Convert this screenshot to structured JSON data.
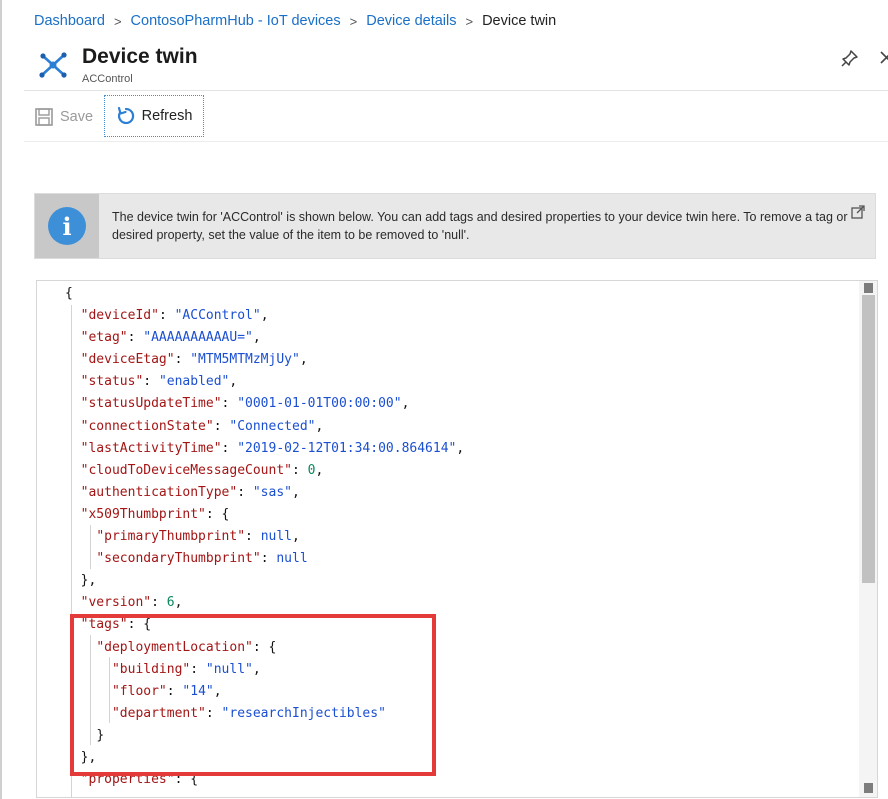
{
  "breadcrumb": {
    "items": [
      "Dashboard",
      "ContosoPharmHub - IoT devices",
      "Device details"
    ],
    "current": "Device twin",
    "separator": ">"
  },
  "header": {
    "title": "Device twin",
    "subtitle": "ACControl",
    "icon": "device-twin-icon"
  },
  "toolbar": {
    "save_label": "Save",
    "refresh_label": "Refresh"
  },
  "info_banner": {
    "text": "The device twin for 'ACControl' is shown below. You can add tags and desired properties to your device twin here. To remove a tag or desired property, set the value of the item to be removed to 'null'."
  },
  "colors": {
    "link": "#1a6fc7",
    "json_key": "#a31515",
    "json_string": "#1b4fd1",
    "json_number": "#09885a",
    "highlight": "#e43a3a",
    "info_icon": "#3d8fd8"
  },
  "editor": {
    "lines": [
      {
        "indent": 0,
        "parts": [
          [
            "p",
            "{"
          ]
        ]
      },
      {
        "indent": 1,
        "parts": [
          [
            "k",
            "\"deviceId\""
          ],
          [
            "p",
            ": "
          ],
          [
            "s",
            "\"ACControl\""
          ],
          [
            "p",
            ","
          ]
        ]
      },
      {
        "indent": 1,
        "parts": [
          [
            "k",
            "\"etag\""
          ],
          [
            "p",
            ": "
          ],
          [
            "s",
            "\"AAAAAAAAAAU=\""
          ],
          [
            "p",
            ","
          ]
        ]
      },
      {
        "indent": 1,
        "parts": [
          [
            "k",
            "\"deviceEtag\""
          ],
          [
            "p",
            ": "
          ],
          [
            "s",
            "\"MTM5MTMzMjUy\""
          ],
          [
            "p",
            ","
          ]
        ]
      },
      {
        "indent": 1,
        "parts": [
          [
            "k",
            "\"status\""
          ],
          [
            "p",
            ": "
          ],
          [
            "s",
            "\"enabled\""
          ],
          [
            "p",
            ","
          ]
        ]
      },
      {
        "indent": 1,
        "parts": [
          [
            "k",
            "\"statusUpdateTime\""
          ],
          [
            "p",
            ": "
          ],
          [
            "s",
            "\"0001-01-01T00:00:00\""
          ],
          [
            "p",
            ","
          ]
        ]
      },
      {
        "indent": 1,
        "parts": [
          [
            "k",
            "\"connectionState\""
          ],
          [
            "p",
            ": "
          ],
          [
            "s",
            "\"Connected\""
          ],
          [
            "p",
            ","
          ]
        ]
      },
      {
        "indent": 1,
        "parts": [
          [
            "k",
            "\"lastActivityTime\""
          ],
          [
            "p",
            ": "
          ],
          [
            "s",
            "\"2019-02-12T01:34:00.864614\""
          ],
          [
            "p",
            ","
          ]
        ]
      },
      {
        "indent": 1,
        "parts": [
          [
            "k",
            "\"cloudToDeviceMessageCount\""
          ],
          [
            "p",
            ": "
          ],
          [
            "n",
            "0"
          ],
          [
            "p",
            ","
          ]
        ]
      },
      {
        "indent": 1,
        "parts": [
          [
            "k",
            "\"authenticationType\""
          ],
          [
            "p",
            ": "
          ],
          [
            "s",
            "\"sas\""
          ],
          [
            "p",
            ","
          ]
        ]
      },
      {
        "indent": 1,
        "parts": [
          [
            "k",
            "\"x509Thumbprint\""
          ],
          [
            "p",
            ": {"
          ]
        ]
      },
      {
        "indent": 2,
        "parts": [
          [
            "k",
            "\"primaryThumbprint\""
          ],
          [
            "p",
            ": "
          ],
          [
            "kw",
            "null"
          ],
          [
            "p",
            ","
          ]
        ]
      },
      {
        "indent": 2,
        "parts": [
          [
            "k",
            "\"secondaryThumbprint\""
          ],
          [
            "p",
            ": "
          ],
          [
            "kw",
            "null"
          ]
        ]
      },
      {
        "indent": 1,
        "parts": [
          [
            "p",
            "},"
          ]
        ]
      },
      {
        "indent": 1,
        "parts": [
          [
            "k",
            "\"version\""
          ],
          [
            "p",
            ": "
          ],
          [
            "n",
            "6"
          ],
          [
            "p",
            ","
          ]
        ]
      },
      {
        "indent": 1,
        "parts": [
          [
            "k",
            "\"tags\""
          ],
          [
            "p",
            ": {"
          ]
        ]
      },
      {
        "indent": 2,
        "parts": [
          [
            "k",
            "\"deploymentLocation\""
          ],
          [
            "p",
            ": {"
          ]
        ]
      },
      {
        "indent": 3,
        "parts": [
          [
            "k",
            "\"building\""
          ],
          [
            "p",
            ": "
          ],
          [
            "s",
            "\"null\""
          ],
          [
            "p",
            ","
          ]
        ]
      },
      {
        "indent": 3,
        "parts": [
          [
            "k",
            "\"floor\""
          ],
          [
            "p",
            ": "
          ],
          [
            "s",
            "\"14\""
          ],
          [
            "p",
            ","
          ]
        ]
      },
      {
        "indent": 3,
        "parts": [
          [
            "k",
            "\"department\""
          ],
          [
            "p",
            ": "
          ],
          [
            "s",
            "\"researchInjectibles\""
          ]
        ]
      },
      {
        "indent": 2,
        "parts": [
          [
            "p",
            "}"
          ]
        ]
      },
      {
        "indent": 1,
        "parts": [
          [
            "p",
            "},"
          ]
        ]
      },
      {
        "indent": 1,
        "parts": [
          [
            "k",
            "\"properties\""
          ],
          [
            "p",
            ": {"
          ]
        ]
      }
    ]
  }
}
